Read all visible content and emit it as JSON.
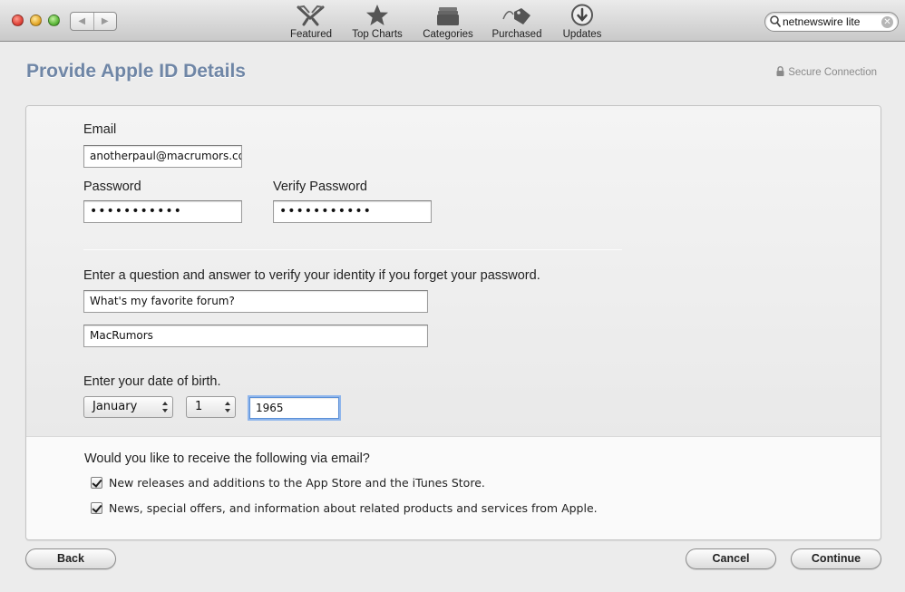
{
  "toolbar": {
    "items": [
      {
        "label": "Featured",
        "icon": "featured-icon"
      },
      {
        "label": "Top Charts",
        "icon": "star-icon"
      },
      {
        "label": "Categories",
        "icon": "categories-icon"
      },
      {
        "label": "Purchased",
        "icon": "tag-icon"
      },
      {
        "label": "Updates",
        "icon": "download-icon"
      }
    ],
    "search": {
      "value": "netnewswire lite"
    }
  },
  "header": {
    "title": "Provide Apple ID Details",
    "secure": "Secure Connection"
  },
  "form": {
    "email_label": "Email",
    "email_value": "anotherpaul@macrumors.com",
    "password_label": "Password",
    "password_value": "•••••••••••",
    "verify_label": "Verify Password",
    "verify_value": "•••••••••••",
    "question_prompt": "Enter a question and answer to verify your identity if you forget your password.",
    "question_value": "What's my favorite forum?",
    "answer_value": "MacRumors",
    "dob_label": "Enter your date of birth.",
    "dob_month": "January",
    "dob_day": "1",
    "dob_year": "1965"
  },
  "email_prefs": {
    "prompt": "Would you like to receive the following via email?",
    "options": [
      {
        "label": "New releases and additions to the App Store and the iTunes Store.",
        "checked": true
      },
      {
        "label": "News, special offers, and information about related products and services from Apple.",
        "checked": true
      }
    ]
  },
  "buttons": {
    "back": "Back",
    "cancel": "Cancel",
    "continue": "Continue"
  },
  "colors": {
    "title": "#6f86a6",
    "focus_ring": "#8fb6ec"
  }
}
